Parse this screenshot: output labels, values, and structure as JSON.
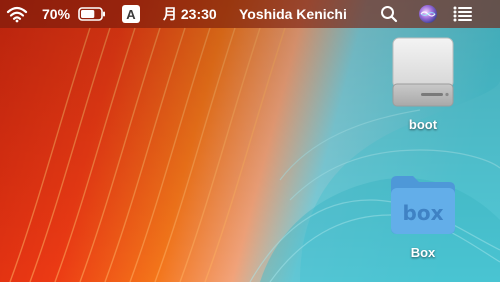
{
  "menubar": {
    "wifi_icon": "wifi-icon",
    "battery_percent": "70%",
    "battery_level": 0.7,
    "input_source": "A",
    "clock": "月 23:30",
    "user_name": "Yoshida Kenichi",
    "search_icon": "spotlight-search-icon",
    "siri_icon": "siri-icon",
    "notification_icon": "notification-center-icon"
  },
  "desktop": {
    "icons": [
      {
        "label": "boot",
        "icon": "hard-drive-icon"
      },
      {
        "label": "Box",
        "icon": "box-folder-icon",
        "folder_text": "box"
      }
    ]
  },
  "colors": {
    "wallpaper_left": "#e8300f",
    "wallpaper_mid": "#f57a1a",
    "wallpaper_right": "#4fc9d6",
    "folder_blue": "#5ea8e6"
  }
}
